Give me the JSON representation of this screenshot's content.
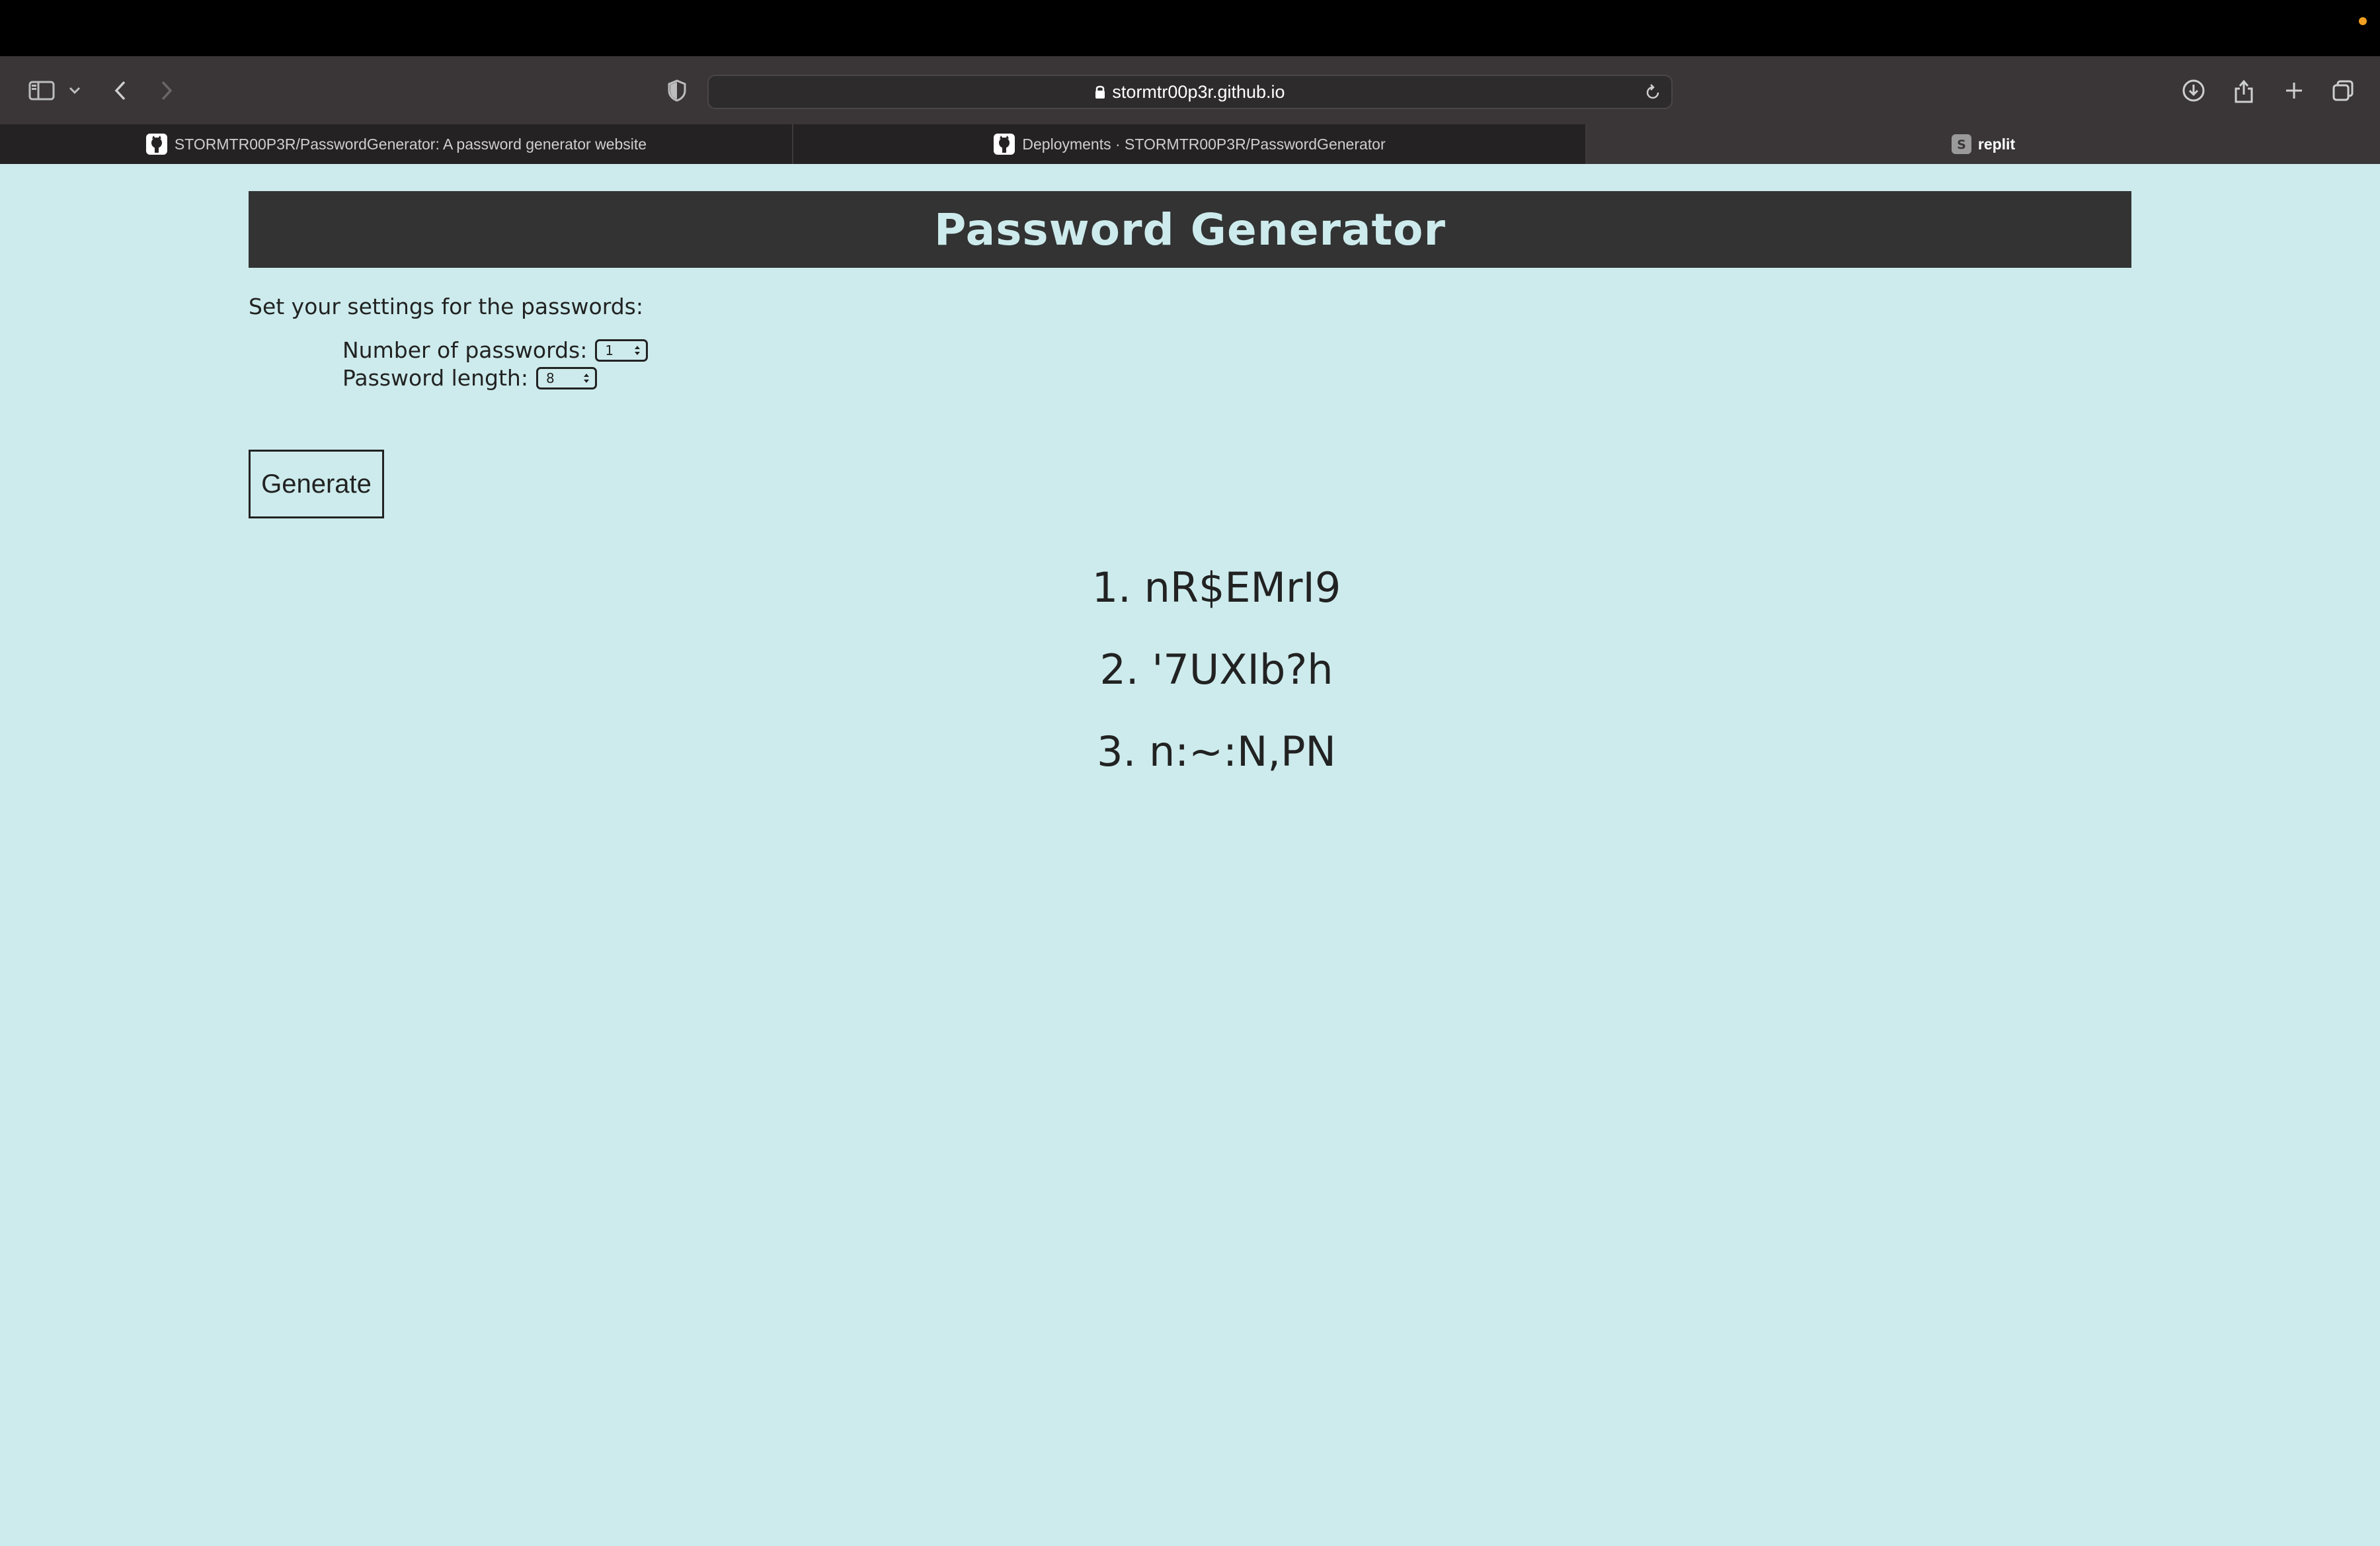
{
  "browser": {
    "address": "stormtr00p3r.github.io",
    "tabs": [
      {
        "label": "STORMTR00P3R/PasswordGenerator: A password generator website",
        "icon": "github-icon",
        "active": false
      },
      {
        "label": "Deployments · STORMTR00P3R/PasswordGenerator",
        "icon": "github-icon",
        "active": false
      },
      {
        "label": "replit",
        "icon": "replit-icon",
        "active": true
      }
    ]
  },
  "page": {
    "title": "Password Generator",
    "settings_label": "Set your settings for the passwords:",
    "num_passwords_label": "Number of passwords:",
    "num_passwords_value": "1",
    "length_label": "Password length:",
    "length_value": "8",
    "generate_label": "Generate",
    "passwords": [
      "1. nR$EMrI9",
      "2. '7UXIb?h",
      "3. n:~:N,PN"
    ]
  },
  "colors": {
    "page_bg": "#cdebec",
    "header_bg": "#333333",
    "header_text": "#cdebec"
  }
}
